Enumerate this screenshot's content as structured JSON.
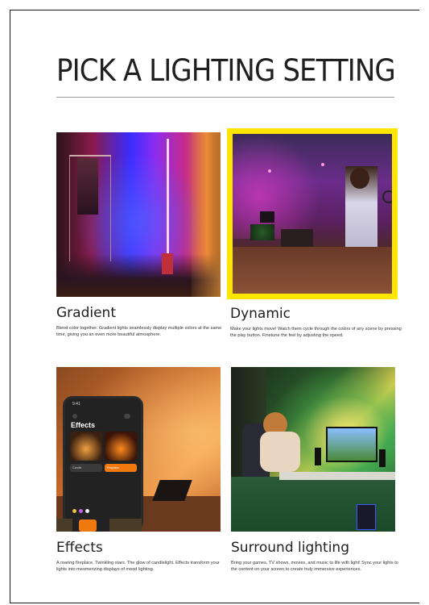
{
  "page": {
    "title": "PICK A LIGHTING SETTING"
  },
  "cards": [
    {
      "title": "Gradient",
      "desc": "Blend color together. Gradient lights seamlessly display multiple colors at the same time, giving you an even more beautiful atmosphere.",
      "highlighted": false
    },
    {
      "title": "Dynamic",
      "desc": "Make your lights move! Watch them cycle through the colors of any scene by pressing the play button. Finetune the feel by adjusting the speed.",
      "highlighted": true
    },
    {
      "title": "Effects",
      "desc": "A roaring fireplace. Twinkling stars. The glow of candlelight. Effects transform your lights into mesmerizing displays of mood lighting.",
      "highlighted": false
    },
    {
      "title": "Surround lighting",
      "desc": "Bring your games, TV shows, movies, and music to life with light! Sync your lights to the content on your screen to create truly immersive experiences.",
      "highlighted": false
    }
  ],
  "phone": {
    "time": "9:41",
    "heading": "Effects",
    "tile_left": "Candle",
    "tile_right": "Fireplace"
  },
  "colors": {
    "highlight": "#ffe600"
  }
}
